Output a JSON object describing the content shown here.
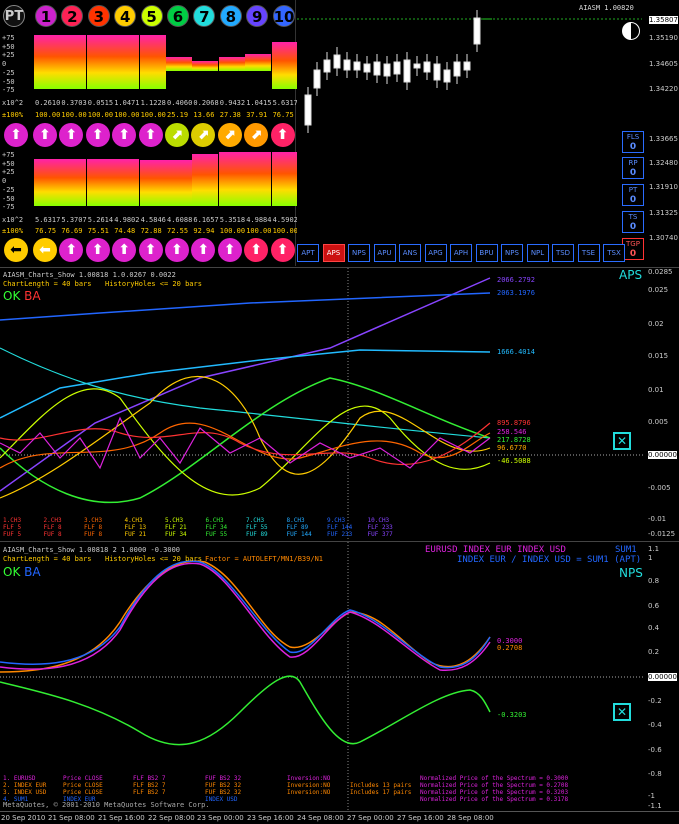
{
  "panel": {
    "pt_label": "PT",
    "numbers": [
      "1",
      "2",
      "3",
      "4",
      "5",
      "6",
      "7",
      "8",
      "9",
      "10"
    ],
    "number_colors": [
      "#cc22cc",
      "#ff2255",
      "#ff3300",
      "#ffcc00",
      "#ccff00",
      "#00cc44",
      "#22dddd",
      "#22aaff",
      "#6644ff",
      "#3366ff"
    ],
    "scale_labels": [
      "+75",
      "+50",
      "+25",
      "0",
      "-25",
      "-50",
      "-75"
    ],
    "row1_prefix": "x10^2",
    "row1_values": [
      "0.2610",
      "0.3703",
      "0.0515",
      "1.0471",
      "1.1228",
      "0.4060",
      "0.2068",
      "0.9432",
      "1.0415",
      "5.6317"
    ],
    "row2_prefix": "±100%",
    "row2_values": [
      "100.00",
      "100.00",
      "100.00",
      "100.00",
      "100.00",
      "25.19",
      "13.66",
      "27.38",
      "37.91",
      "76.75"
    ],
    "row3_prefix": "x10^2",
    "row3_values": [
      "5.6317",
      "5.3707",
      "5.2614",
      "4.9802",
      "4.5846",
      "4.6088",
      "6.1657",
      "5.3518",
      "4.9884",
      "4.5902"
    ],
    "row4_prefix": "±100%",
    "row4_values": [
      "76.75",
      "76.69",
      "75.51",
      "74.48",
      "72.88",
      "72.55",
      "92.94",
      "100.00",
      "100.00",
      "100.00"
    ],
    "top_levels": [
      100,
      100,
      100,
      100,
      100,
      25.19,
      13.66,
      27.38,
      37.91,
      76.75
    ],
    "bottom_levels": [
      76.75,
      76.69,
      75.51,
      74.48,
      72.88,
      72.55,
      92.94,
      100,
      100,
      100
    ],
    "top_arrows": [
      "up",
      "up",
      "up",
      "up",
      "up",
      "ne",
      "ne",
      "ne",
      "ne",
      "up"
    ],
    "top_arrow_colors": [
      "#dd22cc",
      "#dd22cc",
      "#dd22cc",
      "#dd22cc",
      "#dd22cc",
      "#bbdd00",
      "#ddcc00",
      "#ffaa00",
      "#ff9900",
      "#ff2266"
    ],
    "bottom_arrows": [
      "left",
      "up",
      "up",
      "up",
      "up",
      "up",
      "up",
      "up",
      "up",
      "up"
    ],
    "bottom_arrow_colors": [
      "#ffcc00",
      "#dd22cc",
      "#dd22cc",
      "#dd22cc",
      "#dd22cc",
      "#dd22cc",
      "#dd22cc",
      "#dd22cc",
      "#ff2266",
      "#ff2266"
    ],
    "buttons": [
      "APT",
      "APS",
      "NPS",
      "APU",
      "ANS",
      "APG",
      "APH",
      "BPU",
      "NPS",
      "NPL",
      "TSD",
      "TSE",
      "TSX"
    ]
  },
  "price_chart": {
    "symbol_label": "AIASM 1.00820",
    "current_price": "1.35807",
    "price_ticks": [
      "1.35807",
      "1.35190",
      "1.34605",
      "1.34220",
      "1.33665",
      "1.32480",
      "1.31910",
      "1.31325",
      "1.30740"
    ],
    "side_buttons": [
      {
        "label": "FLS",
        "sub": "0"
      },
      {
        "label": "RP",
        "sub": "0"
      },
      {
        "label": "PT",
        "sub": "0"
      },
      {
        "label": "TS",
        "sub": "0"
      },
      {
        "label": "TGP",
        "sub": "0"
      }
    ]
  },
  "aps_chart": {
    "title": "AIASM_Charts_Show 1.00818 1.0.0267 0.0022",
    "chart_length": "ChartLength = 40 bars",
    "history_holes": "HistoryHoles <= 20 bars",
    "ok_label": "OK",
    "ba_label": "BA",
    "tag": "APS",
    "y_ticks": [
      "0.0285",
      "0.025",
      "0.02",
      "0.015",
      "0.01",
      "0.005",
      "0.00000",
      "-0.005",
      "-0.01",
      "-0.0125"
    ],
    "value_labels": [
      {
        "text": "2066.2792",
        "color": "#8844ff"
      },
      {
        "text": "2063.1976",
        "color": "#2266ff"
      },
      {
        "text": "1666.4014",
        "color": "#22bbff"
      },
      {
        "text": "895.8796",
        "color": "#ff3333"
      },
      {
        "text": "258.546",
        "color": "#dd22dd"
      },
      {
        "text": "217.8728",
        "color": "#33ee33"
      },
      {
        "text": "96.6770",
        "color": "#ffaa00"
      },
      {
        "text": "-46.5088",
        "color": "#ccff00"
      }
    ],
    "legend_cols": [
      {
        "h": "1.CH3",
        "a": "FLF 5",
        "b": "FUF 5",
        "color": "#ff3333"
      },
      {
        "h": "2.CH3",
        "a": "FLF 8",
        "b": "FUF 8",
        "color": "#ff3333"
      },
      {
        "h": "3.CH3",
        "a": "FLF 8",
        "b": "FUF 8",
        "color": "#ff6600"
      },
      {
        "h": "4.CH3",
        "a": "FLF 13",
        "b": "FUF 21",
        "color": "#ffcc00"
      },
      {
        "h": "5.CH3",
        "a": "FLF 21",
        "b": "FUF 34",
        "color": "#ccff00"
      },
      {
        "h": "6.CH3",
        "a": "FLF 34",
        "b": "FUF 55",
        "color": "#33ee33"
      },
      {
        "h": "7.CH3",
        "a": "FLF 55",
        "b": "FUF 89",
        "color": "#22dddd"
      },
      {
        "h": "8.CH3",
        "a": "FLF 89",
        "b": "FUF 144",
        "color": "#22aaff"
      },
      {
        "h": "9.CH3",
        "a": "FLF 144",
        "b": "FUF 233",
        "color": "#2266ff"
      },
      {
        "h": "10.CH3",
        "a": "FLF 233",
        "b": "FUF 377",
        "color": "#8844ff"
      }
    ]
  },
  "nps_chart": {
    "title": "AIASM_Charts_Show 1.00818 2 1.0000 -0.3000",
    "chart_length": "ChartLength = 40 bars",
    "history_holes": "HistoryHoles <= 20 bars",
    "factor": "Factor = AUTOLEFT/MN1/B39/N1",
    "ok_label": "OK",
    "ba_label": "BA",
    "tag": "NPS",
    "series_header1": "EURUSD  INDEX EUR  INDEX USD",
    "sum_label": "SUM1",
    "series_header2": "INDEX EUR / INDEX USD = SUM1 (APT)",
    "y_ticks": [
      "1.1",
      "1",
      "0.8",
      "0.6",
      "0.4",
      "0.2",
      "0.00000",
      "-0.2",
      "-0.4",
      "-0.6",
      "-0.8",
      "-1",
      "-1.1"
    ],
    "value_labels": [
      {
        "text": "0.3000",
        "color": "#dd22dd"
      },
      {
        "text": "0.2708",
        "color": "#ff8800"
      },
      {
        "text": "-0.3203",
        "color": "#33ee33"
      }
    ],
    "legend_rows": [
      {
        "a": "1. EURUSD",
        "b": "Price CLOSE",
        "c": "FLF BS2 7",
        "d": "FUF BS2 32",
        "e": "Inversion:NO",
        "f": "",
        "g": "Normalized Price of the Spectrum = 0.3000",
        "color": "#dd22dd"
      },
      {
        "a": "2. INDEX EUR",
        "b": "Price CLOSE",
        "c": "FLF BS2 7",
        "d": "FUF BS2 32",
        "e": "Inversion:NO",
        "f": "Includes 13 pairs",
        "g": "Normalized Price of the Spectrum = 0.2708",
        "color": "#ff8800"
      },
      {
        "a": "3. INDEX USD",
        "b": "Price CLOSE",
        "c": "FLF BS2 7",
        "d": "FUF BS2 32",
        "e": "Inversion:NO",
        "f": "Includes 17 pairs",
        "g": "Normalized Price of the Spectrum = 0.3203",
        "color": "#ff8800"
      },
      {
        "a": "4. SUM1",
        "b": "INDEX EUR",
        "c": "",
        "d": "INDEX USD",
        "e": "",
        "f": "",
        "g": "Normalized Price of the Spectrum = 0.3178",
        "color": "#2266ff"
      }
    ],
    "copyright": "MetaQuotes, © 2001-2010 MetaQuotes Software Corp."
  },
  "time_axis": [
    "20 Sep 2010",
    "21 Sep 08:00",
    "21 Sep 16:00",
    "22 Sep 08:00",
    "23 Sep 00:00",
    "23 Sep 16:00",
    "24 Sep 08:00",
    "27 Sep 00:00",
    "27 Sep 16:00",
    "28 Sep 08:00"
  ]
}
